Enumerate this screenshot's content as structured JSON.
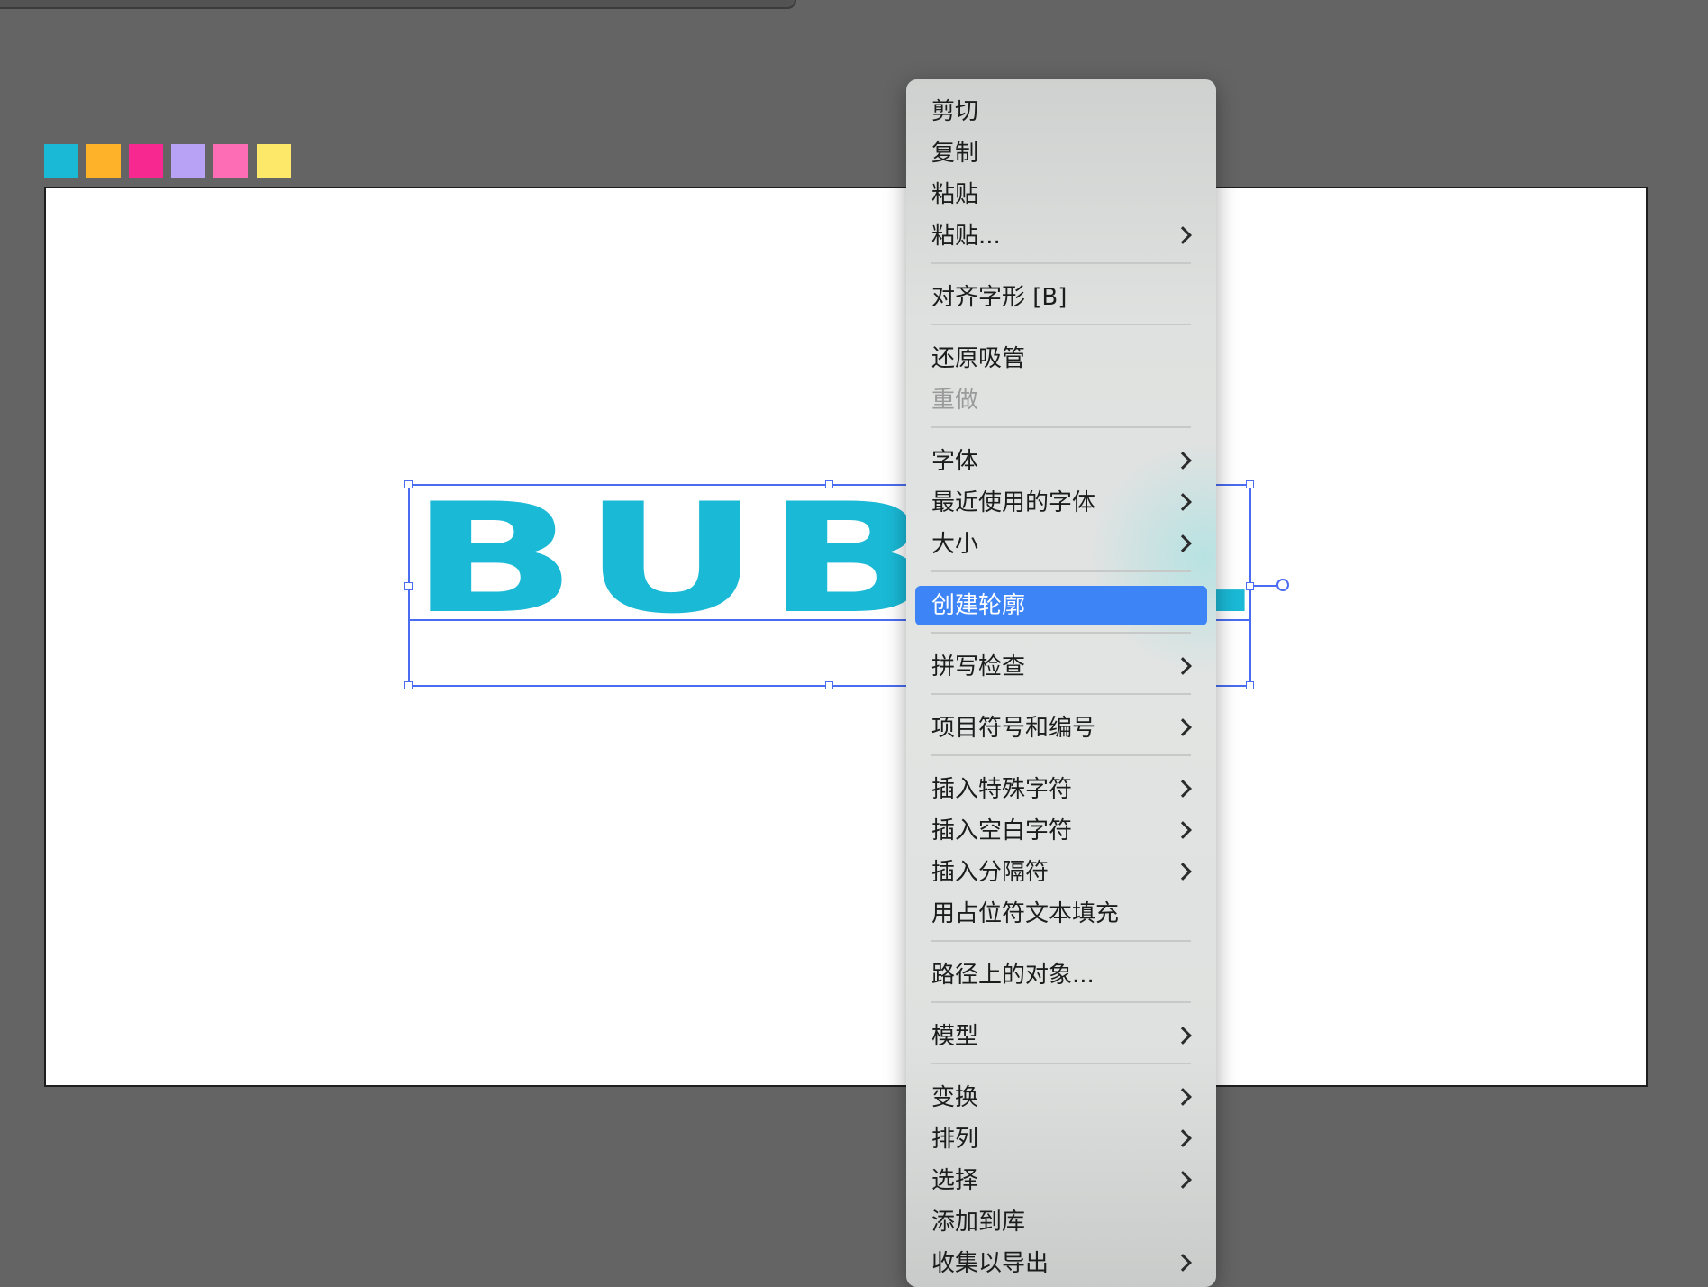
{
  "swatches": [
    {
      "color": "#1ab9d6"
    },
    {
      "color": "#fdb22a"
    },
    {
      "color": "#f7288f"
    },
    {
      "color": "#b7a2f5"
    },
    {
      "color": "#fd6db5"
    },
    {
      "color": "#fee869"
    }
  ],
  "canvas": {
    "text": "BUBBLE",
    "text_color": "#1ab9d6",
    "selection_color": "#4a6cf0"
  },
  "context_menu": {
    "items": [
      {
        "label": "剪切"
      },
      {
        "label": "复制"
      },
      {
        "label": "粘贴"
      },
      {
        "label": "粘贴...",
        "submenu": true
      },
      {
        "separator": true
      },
      {
        "label": "对齐字形 [B]"
      },
      {
        "separator": true
      },
      {
        "label": "还原吸管"
      },
      {
        "label": "重做",
        "disabled": true
      },
      {
        "separator": true
      },
      {
        "label": "字体",
        "submenu": true
      },
      {
        "label": "最近使用的字体",
        "submenu": true
      },
      {
        "label": "大小",
        "submenu": true
      },
      {
        "separator": true
      },
      {
        "label": "创建轮廓",
        "highlighted": true
      },
      {
        "separator": true
      },
      {
        "label": "拼写检查",
        "submenu": true
      },
      {
        "separator": true
      },
      {
        "label": "项目符号和编号",
        "submenu": true
      },
      {
        "separator": true
      },
      {
        "label": "插入特殊字符",
        "submenu": true
      },
      {
        "label": "插入空白字符",
        "submenu": true
      },
      {
        "label": "插入分隔符",
        "submenu": true
      },
      {
        "label": "用占位符文本填充"
      },
      {
        "separator": true
      },
      {
        "label": "路径上的对象..."
      },
      {
        "separator": true
      },
      {
        "label": "模型",
        "submenu": true
      },
      {
        "separator": true
      },
      {
        "label": "变换",
        "submenu": true
      },
      {
        "label": "排列",
        "submenu": true
      },
      {
        "label": "选择",
        "submenu": true
      },
      {
        "label": "添加到库"
      },
      {
        "label": "收集以导出",
        "submenu": true
      }
    ]
  }
}
